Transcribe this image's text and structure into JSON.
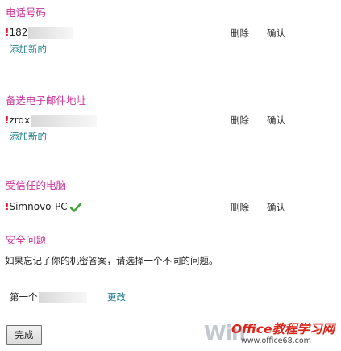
{
  "phone_section": {
    "heading": "电话号码",
    "entry": {
      "marker": "!",
      "value": "182"
    },
    "delete_label": "删除",
    "confirm_label": "确认",
    "add_new_label": "添加新的"
  },
  "email_section": {
    "heading": "备选电子邮件地址",
    "entry": {
      "marker": "!",
      "value": "zrqx"
    },
    "delete_label": "删除",
    "confirm_label": "确认",
    "add_new_label": "添加新的"
  },
  "trusted_pc_section": {
    "heading": "受信任的电脑",
    "entry": {
      "marker": "!",
      "value": "Simnovo-PC",
      "check_color": "#3fa535"
    },
    "delete_label": "删除",
    "confirm_label": "确认"
  },
  "security_section": {
    "heading": "安全问题",
    "description": "如果忘记了你的机密答案，请选择一个不同的问题。",
    "question_prefix": "第一个",
    "change_label": "更改"
  },
  "done_button_label": "完成",
  "watermark": {
    "win_text": "Win",
    "brand_text": "Office教程学习网",
    "url_text": "www.office68.com"
  },
  "colors": {
    "heading": "#c8339a",
    "link": "#1a7a8a",
    "marker": "#e0152b"
  }
}
